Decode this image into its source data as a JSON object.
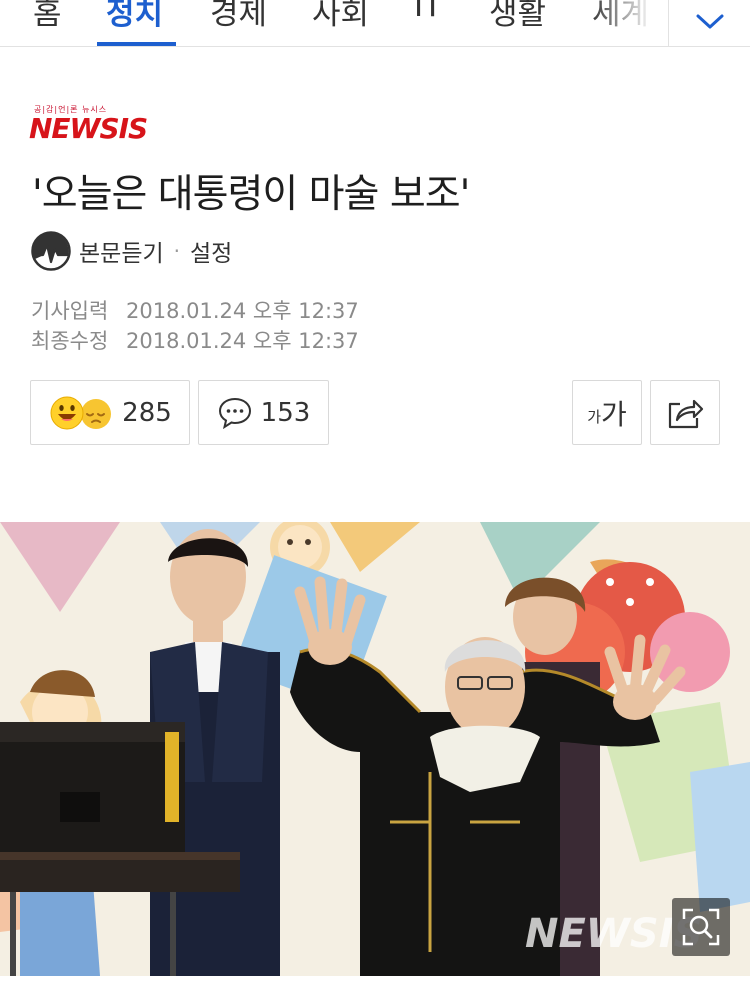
{
  "nav": {
    "tabs": [
      {
        "label": "홈"
      },
      {
        "label": "정치"
      },
      {
        "label": "경제"
      },
      {
        "label": "사회"
      },
      {
        "label": "IT"
      },
      {
        "label": "생활"
      },
      {
        "label": "세계"
      }
    ],
    "active_tab": "정치",
    "more_icon": "chevron-down-icon"
  },
  "press": {
    "tagline": "공|감|언|론 뉴시스",
    "name": "NEWSIS",
    "brand_color": "#d7141a"
  },
  "article": {
    "title": "'오늘은 대통령이 마술 보조'",
    "listen_label": "본문듣기",
    "separator": "·",
    "settings_label": "설정",
    "published_label": "기사입력",
    "published_value": "2018.01.24 오후 12:37",
    "modified_label": "최종수정",
    "modified_value": "2018.01.24 오후 12:37"
  },
  "actions": {
    "reaction_count": "285",
    "comment_count": "153",
    "font_small": "가",
    "font_big": "가"
  },
  "photo": {
    "watermark": "NEWSIS"
  },
  "colors": {
    "accent": "#1d5fcf",
    "text": "#1e1e1e",
    "meta": "#8a8a8a"
  }
}
